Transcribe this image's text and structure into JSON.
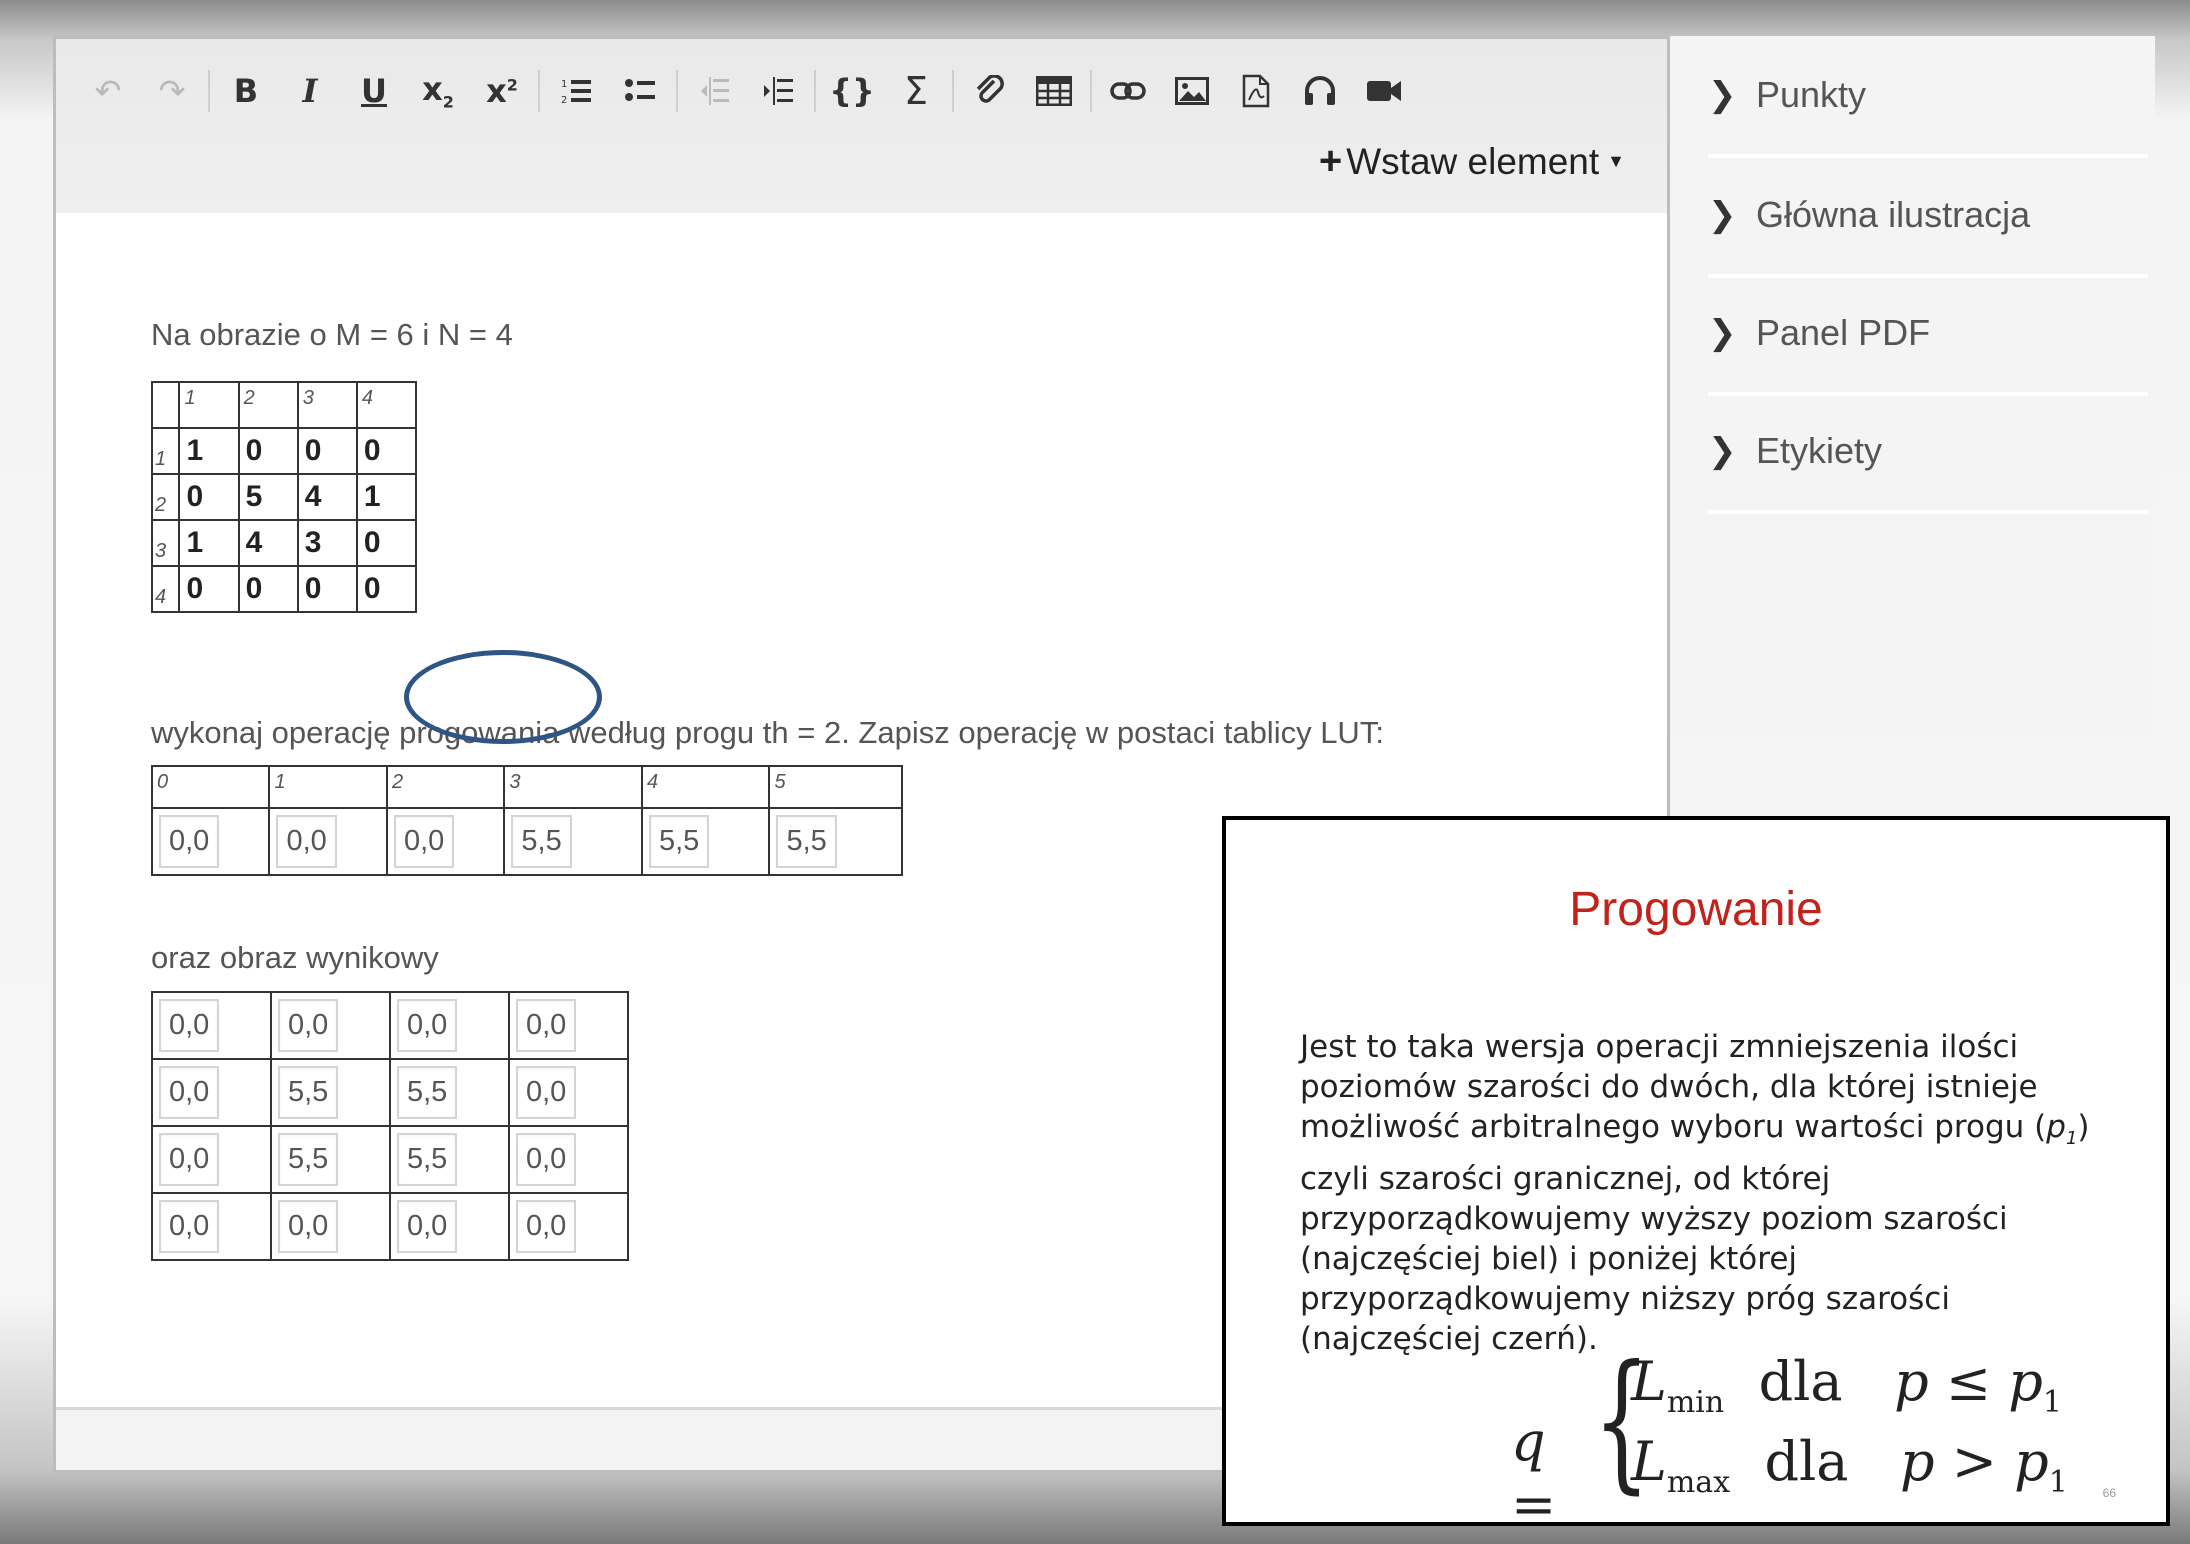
{
  "toolbar": {
    "insert_label": "Wstaw element"
  },
  "content": {
    "intro": "Na obrazie o M = 6 i N = 4",
    "image": {
      "col_idx": [
        "1",
        "2",
        "3",
        "4"
      ],
      "row_idx": [
        "1",
        "2",
        "3",
        "4"
      ],
      "rows": [
        [
          "1",
          "0",
          "0",
          "0"
        ],
        [
          "0",
          "5",
          "4",
          "1"
        ],
        [
          "1",
          "4",
          "3",
          "0"
        ],
        [
          "0",
          "0",
          "0",
          "0"
        ]
      ]
    },
    "task": "wykonaj operację progowania według progu th = 2. Zapisz operację w postaci tablicy LUT:",
    "lut": {
      "idx": [
        "0",
        "1",
        "2",
        "3",
        "4",
        "5"
      ],
      "values": [
        "0,0",
        "0,0",
        "0,0",
        "5,5",
        "5,5",
        "5,5"
      ]
    },
    "result_label": "oraz obraz wynikowy",
    "result": [
      [
        "0,0",
        "0,0",
        "0,0",
        "0,0"
      ],
      [
        "0,0",
        "5,5",
        "5,5",
        "0,0"
      ],
      [
        "0,0",
        "5,5",
        "5,5",
        "0,0"
      ],
      [
        "0,0",
        "0,0",
        "0,0",
        "0,0"
      ]
    ]
  },
  "sidebar": {
    "items": [
      {
        "label": "Punkty"
      },
      {
        "label": "Główna ilustracja"
      },
      {
        "label": "Panel PDF"
      },
      {
        "label": "Etykiety"
      }
    ]
  },
  "slide": {
    "title": "Progowanie",
    "body": "Jest to taka wersja operacji zmniejszenia ilości poziomów szarości do dwóch, dla której istnieje możliwość arbitralnego wyboru wartości progu (p1) czyli szarości granicznej, od której przyporządkowujemy wyższy poziom szarości (najczęściej biel) i poniżej której przyporządkowujemy niższy próg szarości (najczęściej czerń).",
    "formula": {
      "lhs": "q =",
      "row1": "L_min dla p ≤ p1",
      "row2": "L_max dla p > p1"
    },
    "page_number": "66"
  }
}
